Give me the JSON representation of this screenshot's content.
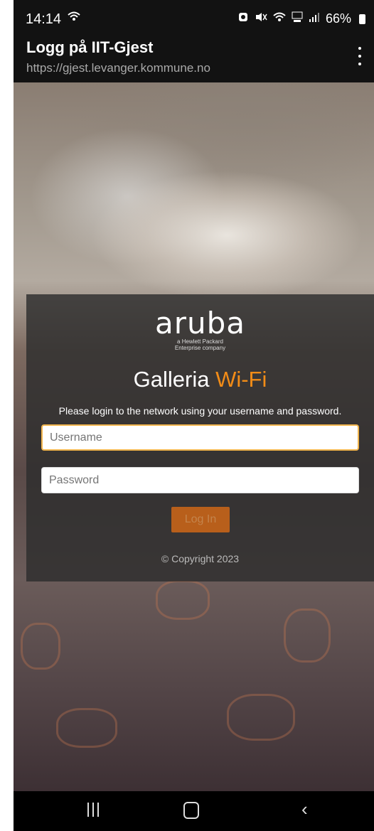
{
  "status_bar": {
    "time": "14:14",
    "wifi_icon": "wifi-icon",
    "icons": [
      "alarm-icon",
      "mute-icon",
      "wifi-icon",
      "5g-icon",
      "signal-icon"
    ],
    "battery": "66%"
  },
  "header": {
    "title": "Logg på IIT-Gjest",
    "url": "https://gjest.levanger.kommune.no"
  },
  "login_panel": {
    "logo_text": "aruba",
    "logo_subtitle_line1": "a Hewlett Packard",
    "logo_subtitle_line2": "Enterprise company",
    "heading_prefix": "Galleria",
    "heading_accent": "Wi-Fi",
    "instructions": "Please login to the network using your username and password.",
    "username_placeholder": "Username",
    "password_placeholder": "Password",
    "login_button": "Log In",
    "copyright": "© Copyright 2023"
  },
  "colors": {
    "accent": "#f28c17",
    "panel": "#2d2d2d",
    "button": "#b85f1b"
  }
}
